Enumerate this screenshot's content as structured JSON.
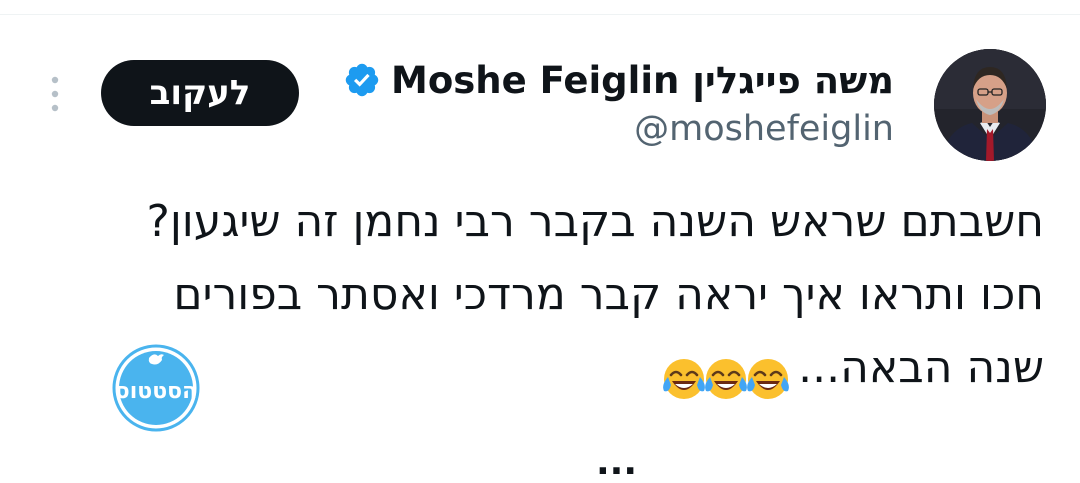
{
  "tweet": {
    "author": {
      "display_name": "משה פייגלין Moshe Feiglin",
      "handle": "@moshefeiglin",
      "verified": true,
      "avatar_icon": "avatar-photo"
    },
    "follow_label": "לעקוב",
    "more_icon": "more-vertical-icon",
    "text_lines": [
      "חשבתם שראש השנה בקבר רבי נחמן זה שיגעון?",
      "חכו ותראו איך יראה קבר מרדכי ואסתר בפורים",
      "שנה הבאה..."
    ],
    "emojis": [
      "😂",
      "😂",
      "😂"
    ],
    "emoji_icon": "face-with-tears-of-joy-icon",
    "watermark_text": "הסטטוס",
    "cutoff_text": "..."
  },
  "colors": {
    "text": "#0f1419",
    "secondary": "#536471",
    "verified": "#1d9bf0",
    "button_bg": "#0f1419",
    "watermark": "#4ab4ee"
  }
}
